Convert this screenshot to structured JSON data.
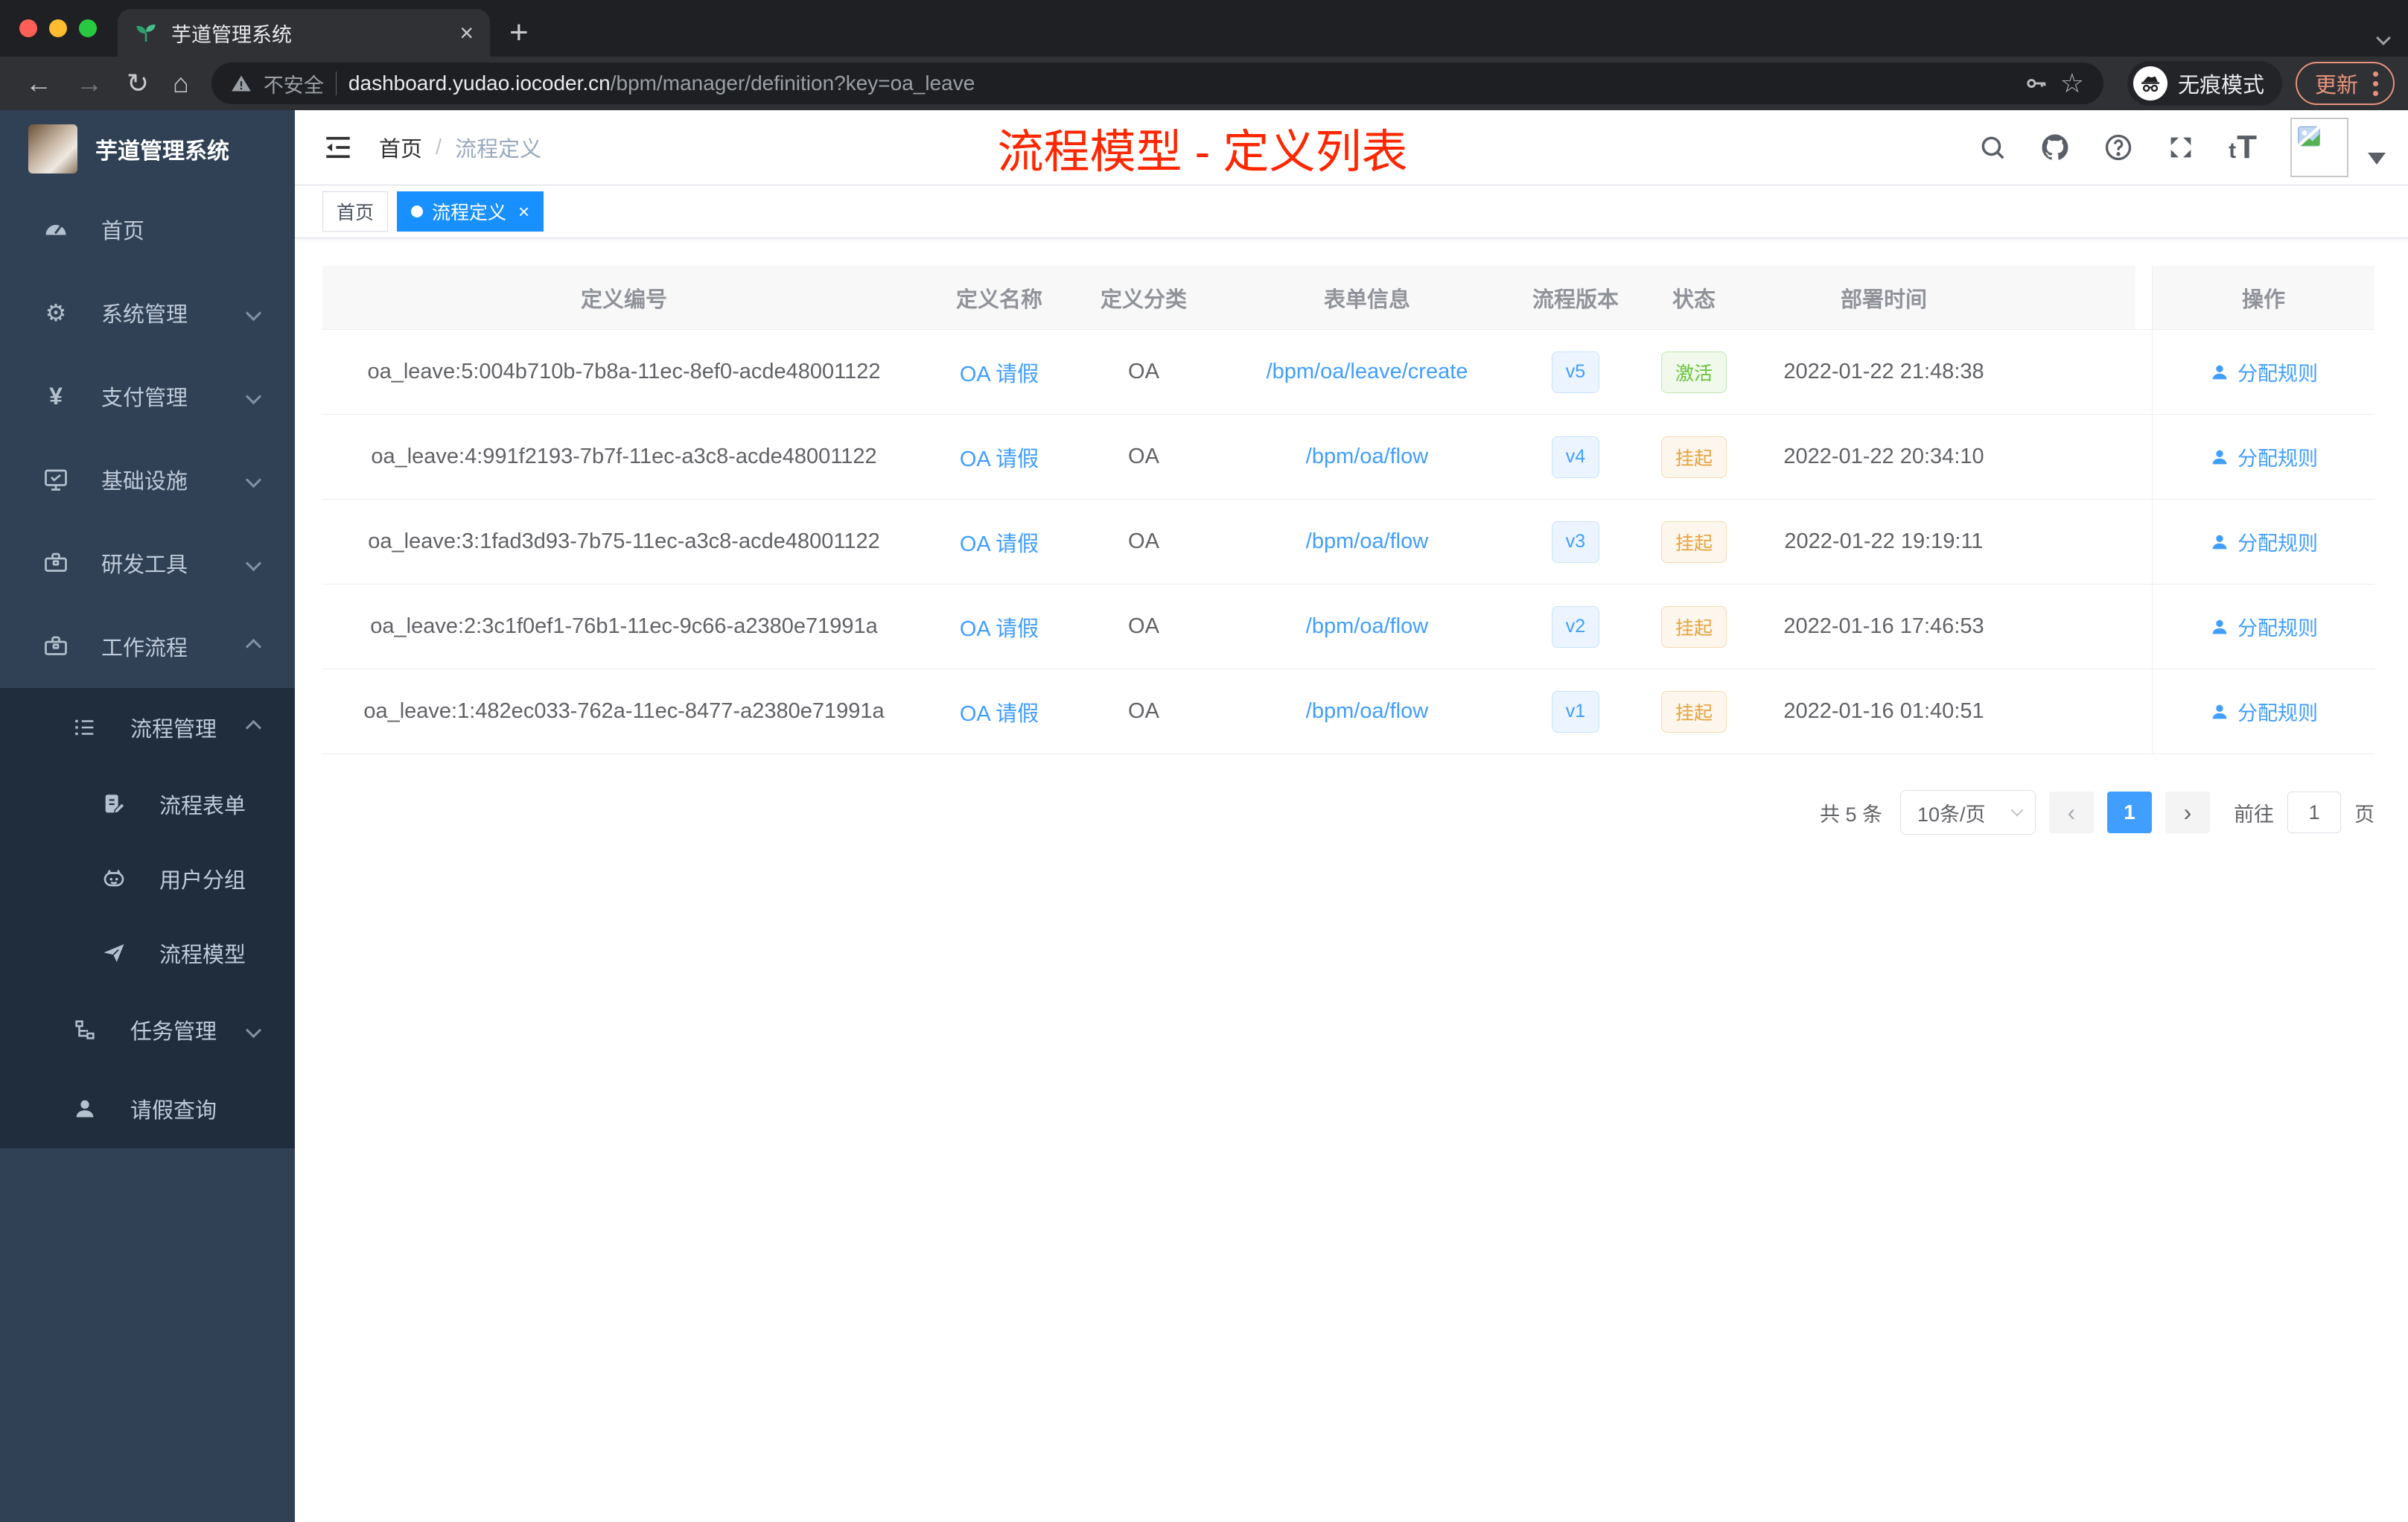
{
  "browser": {
    "traffic_lights": [
      "#ff5f57",
      "#febc2e",
      "#28c840"
    ],
    "tab_title": "芋道管理系统",
    "new_tab": "+",
    "url": {
      "warning_label": "不安全",
      "domain": "dashboard.yudao.iocoder.cn",
      "path": "/bpm/manager/definition?key=oa_leave"
    },
    "incognito_label": "无痕模式",
    "update_label": "更新"
  },
  "sidebar": {
    "logo_title": "芋道管理系统",
    "menu": [
      {
        "label": "首页",
        "icon": "dashboard-icon",
        "level": 1
      },
      {
        "label": "系统管理",
        "icon": "gear-icon",
        "level": 1,
        "expanded": false
      },
      {
        "label": "支付管理",
        "icon": "yen-icon",
        "level": 1,
        "expanded": false
      },
      {
        "label": "基础设施",
        "icon": "monitor-icon",
        "level": 1,
        "expanded": false
      },
      {
        "label": "研发工具",
        "icon": "toolbox-icon",
        "level": 1,
        "expanded": false
      },
      {
        "label": "工作流程",
        "icon": "briefcase-icon",
        "level": 1,
        "expanded": true
      },
      {
        "label": "流程管理",
        "icon": "list-tree-icon",
        "level": 2,
        "expanded": true
      },
      {
        "label": "流程表单",
        "icon": "form-edit-icon",
        "level": 3
      },
      {
        "label": "用户分组",
        "icon": "robot-icon",
        "level": 3
      },
      {
        "label": "流程模型",
        "icon": "paper-plane-icon",
        "level": 3
      },
      {
        "label": "任务管理",
        "icon": "org-tree-icon",
        "level": 2,
        "expanded": false
      },
      {
        "label": "请假查询",
        "icon": "person-icon",
        "level": 2
      }
    ]
  },
  "header": {
    "breadcrumb": [
      "首页",
      "流程定义"
    ],
    "separator": "/",
    "page_title": "流程模型 - 定义列表"
  },
  "tags_view": {
    "tabs": [
      {
        "label": "首页",
        "active": false
      },
      {
        "label": "流程定义",
        "active": true,
        "close": "×"
      }
    ]
  },
  "table": {
    "columns": [
      "定义编号",
      "定义名称",
      "定义分类",
      "表单信息",
      "流程版本",
      "状态",
      "部署时间",
      "操作"
    ],
    "rows": [
      {
        "id": "oa_leave:5:004b710b-7b8a-11ec-8ef0-acde48001122",
        "name": "OA 请假",
        "category": "OA",
        "form": "/bpm/oa/leave/create",
        "version": "v5",
        "status": "激活",
        "status_class": "badge b-success",
        "time": "2022-01-22 21:48:38",
        "action": "分配规则"
      },
      {
        "id": "oa_leave:4:991f2193-7b7f-11ec-a3c8-acde48001122",
        "name": "OA 请假",
        "category": "OA",
        "form": "/bpm/oa/flow",
        "version": "v4",
        "status": "挂起",
        "status_class": "badge b-warning",
        "time": "2022-01-22 20:34:10",
        "action": "分配规则"
      },
      {
        "id": "oa_leave:3:1fad3d93-7b75-11ec-a3c8-acde48001122",
        "name": "OA 请假",
        "category": "OA",
        "form": "/bpm/oa/flow",
        "version": "v3",
        "status": "挂起",
        "status_class": "badge b-warning",
        "time": "2022-01-22 19:19:11",
        "action": "分配规则"
      },
      {
        "id": "oa_leave:2:3c1f0ef1-76b1-11ec-9c66-a2380e71991a",
        "name": "OA 请假",
        "category": "OA",
        "form": "/bpm/oa/flow",
        "version": "v2",
        "status": "挂起",
        "status_class": "badge b-warning",
        "time": "2022-01-16 17:46:53",
        "action": "分配规则"
      },
      {
        "id": "oa_leave:1:482ec033-762a-11ec-8477-a2380e71991a",
        "name": "OA 请假",
        "category": "OA",
        "form": "/bpm/oa/flow",
        "version": "v1",
        "status": "挂起",
        "status_class": "badge b-warning",
        "time": "2022-01-16 01:40:51",
        "action": "分配规则"
      }
    ]
  },
  "pagination": {
    "total": "共 5 条",
    "page_size": "10条/页",
    "prev": "‹",
    "current_page": "1",
    "next": "›",
    "goto_label": "前往",
    "goto_value": "1",
    "page_unit": "页"
  },
  "colors": {
    "accent_link": "#409eff",
    "active_tag": "#1890ff",
    "title_red": "#ff2600",
    "status_active": "#67c23a",
    "status_suspended": "#e6a23c",
    "sidebar_bg": "#304156",
    "submenu_bg": "#1f2d3d"
  }
}
